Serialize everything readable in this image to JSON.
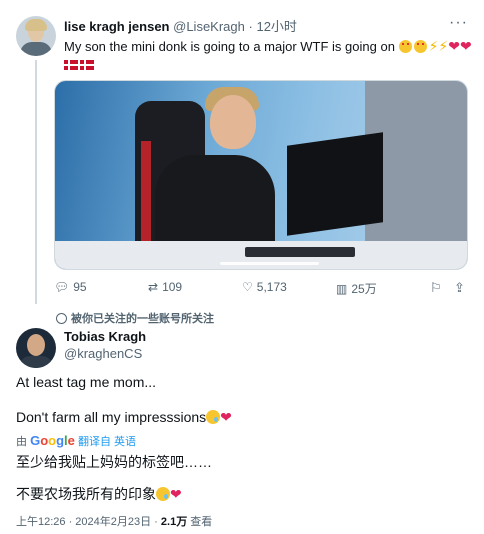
{
  "quoted_tweet": {
    "author_name": "lise kragh jensen",
    "author_handle": "@LiseKragh",
    "separator": "·",
    "time": "12小时",
    "more_label": "···",
    "text": "My son the mini donk is going to a major WTF is going on",
    "emojis": [
      "star-struck-emoji",
      "star-struck-emoji",
      "lightning-emoji",
      "lightning-emoji",
      "red-heart-emoji",
      "red-heart-emoji",
      "denmark-flag-emoji"
    ],
    "stats": {
      "replies": "95",
      "retweets": "109",
      "likes": "5,173",
      "views": "25万"
    },
    "icons": {
      "reply": "reply-icon",
      "retweet": "retweet-icon",
      "like": "heart-icon",
      "views": "bar-chart-icon",
      "bookmark": "bookmark-icon",
      "share": "share-icon"
    },
    "video_progress": 0.24
  },
  "notice": "被你已关注的一些账号所关注",
  "reply_tweet": {
    "author_name": "Tobias Kragh",
    "author_handle": "@kraghenCS",
    "line1": "At least tag me mom...",
    "line2": "Don't farm all my impresssions",
    "translate_prefix": "由",
    "translate_link": "翻译自 英语",
    "translated_line1": "至少给我贴上妈妈的标签吧……",
    "translated_line2": "不要农场我所有的印象",
    "timestamp": "上午12:26 · 2024年2月23日 ·",
    "view_count": "2.1万",
    "view_label": "查看"
  },
  "colors": {
    "text": "#0f1419",
    "muted": "#536471",
    "link": "#1d9bf0",
    "heart": "#e0245e"
  }
}
